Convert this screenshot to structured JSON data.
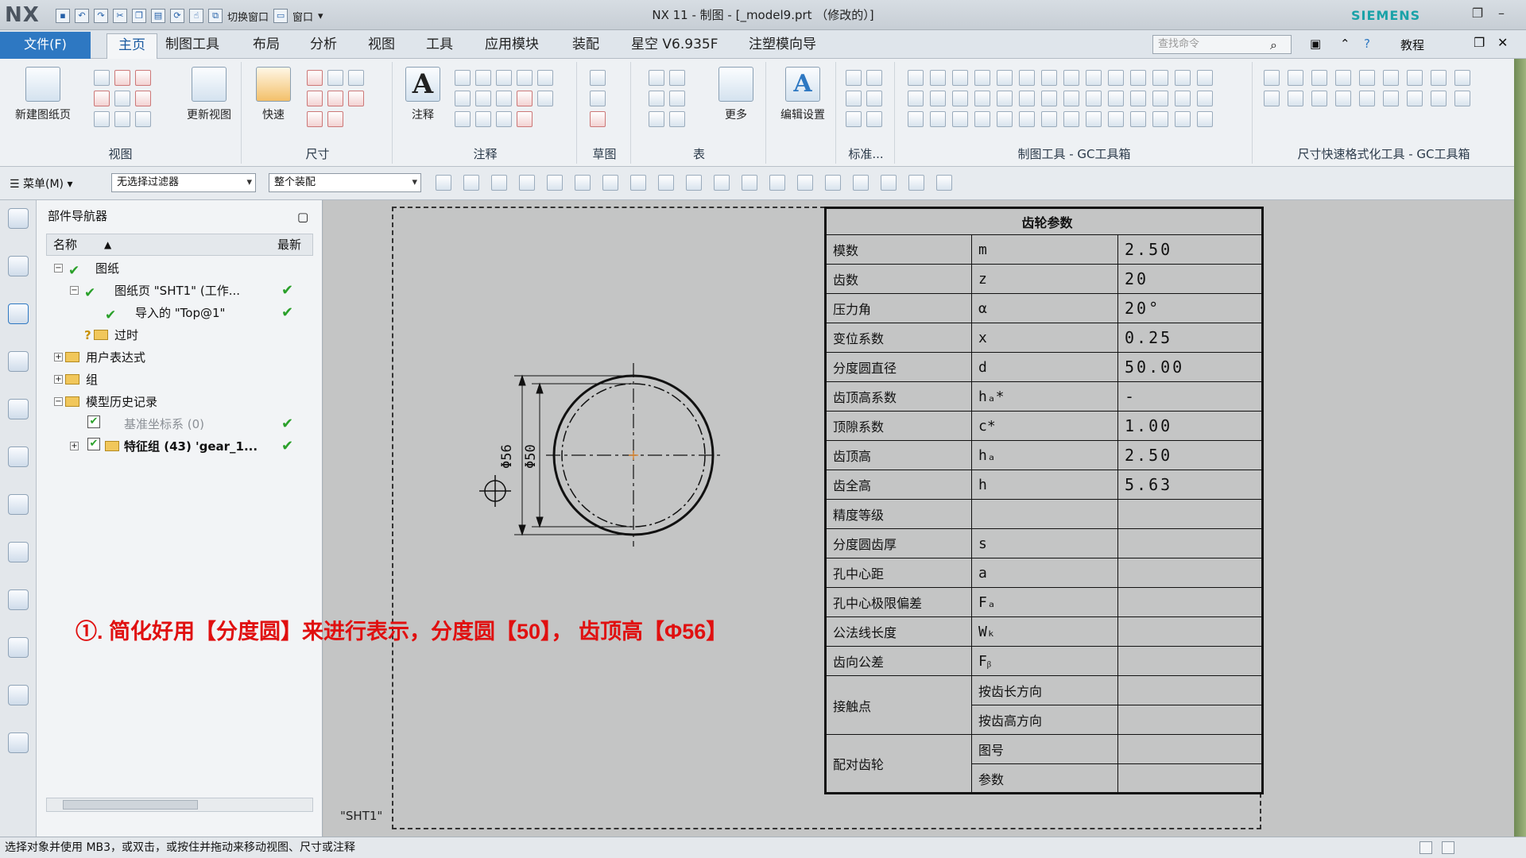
{
  "titlebar": {
    "logo": "NX",
    "switch_window": "切换窗口",
    "window_menu": "窗口",
    "title": "NX 11 - 制图 - [_model9.prt （修改的）]",
    "brand": "SIEMENS"
  },
  "menubar": {
    "file": "文件(F)",
    "tabs": [
      "主页",
      "制图工具",
      "布局",
      "分析",
      "视图",
      "工具",
      "应用模块",
      "装配",
      "星空 V6.935F",
      "注塑模向导"
    ],
    "active_tab": "主页",
    "search_placeholder": "查找命令",
    "tutorial": "教程"
  },
  "ribbon": {
    "new_sheet": "新建图纸页",
    "update_view": "更新视图",
    "quick": "快速",
    "annotation": "注释",
    "more": "更多",
    "edit_settings": "编辑设置",
    "groups": {
      "view": "视图",
      "dimension": "尺寸",
      "annotation": "注释",
      "sketch": "草图",
      "table": "表",
      "standard": "标准...",
      "gc_drafting": "制图工具 - GC工具箱",
      "gc_dimension": "尺寸快速格式化工具 - GC工具箱"
    }
  },
  "toolbar2": {
    "menu": "菜单(M)",
    "filter": "无选择过滤器",
    "scope": "整个装配"
  },
  "navigator": {
    "title": "部件导航器",
    "col_name": "名称",
    "col_latest": "最新",
    "rows": [
      {
        "label": "图纸",
        "check": "✔"
      },
      {
        "label": "图纸页 \"SHT1\" (工作...",
        "check": "✔"
      },
      {
        "label": "导入的 \"Top@1\"",
        "check": "✔"
      },
      {
        "label": "过时",
        "check": ""
      },
      {
        "label": "用户表达式",
        "check": ""
      },
      {
        "label": "组",
        "check": ""
      },
      {
        "label": "模型历史记录",
        "check": ""
      },
      {
        "label": "基准坐标系 (0)",
        "check": "✔"
      },
      {
        "label": "特征组 (43) 'gear_1...",
        "check": "✔"
      }
    ]
  },
  "drawing": {
    "dim_outer": "Φ56",
    "dim_pitch": "Φ50",
    "sheet_name": "\"SHT1\""
  },
  "param_table": {
    "title": "齿轮参数",
    "rows": [
      {
        "name": "模数",
        "symbol": "m",
        "value": "2.50"
      },
      {
        "name": "齿数",
        "symbol": "z",
        "value": "20"
      },
      {
        "name": "压力角",
        "symbol": "α",
        "value": "20°"
      },
      {
        "name": "变位系数",
        "symbol": "x",
        "value": "0.25"
      },
      {
        "name": "分度圆直径",
        "symbol": "d",
        "value": "50.00"
      },
      {
        "name": "齿顶高系数",
        "symbol": "hₐ*",
        "value": "-"
      },
      {
        "name": "顶隙系数",
        "symbol": "c*",
        "value": "1.00"
      },
      {
        "name": "齿顶高",
        "symbol": "hₐ",
        "value": "2.50"
      },
      {
        "name": "齿全高",
        "symbol": "h",
        "value": "5.63"
      },
      {
        "name": "精度等级",
        "symbol": "",
        "value": ""
      },
      {
        "name": "分度圆齿厚",
        "symbol": "s",
        "value": ""
      },
      {
        "name": "孔中心距",
        "symbol": "a",
        "value": ""
      },
      {
        "name": "孔中心极限偏差",
        "symbol": "Fₐ",
        "value": ""
      },
      {
        "name": "公法线长度",
        "symbol": "Wₖ",
        "value": ""
      },
      {
        "name": "齿向公差",
        "symbol": "Fᵦ",
        "value": ""
      }
    ],
    "contact": {
      "name": "接触点",
      "sub1": "按齿长方向",
      "sub2": "按齿高方向"
    },
    "mating": {
      "name": "配对齿轮",
      "sub1": "图号",
      "sub2": "参数"
    }
  },
  "caption": "①. 简化好用【分度圆】来进行表示，分度圆【50】， 齿顶高【Φ56】",
  "statusbar": "选择对象并使用 MB3，或双击，或按住并拖动来移动视图、尺寸或注释",
  "colors": {
    "accent": "#2e78c2",
    "caption": "#e01010",
    "check": "#2aa02a"
  }
}
